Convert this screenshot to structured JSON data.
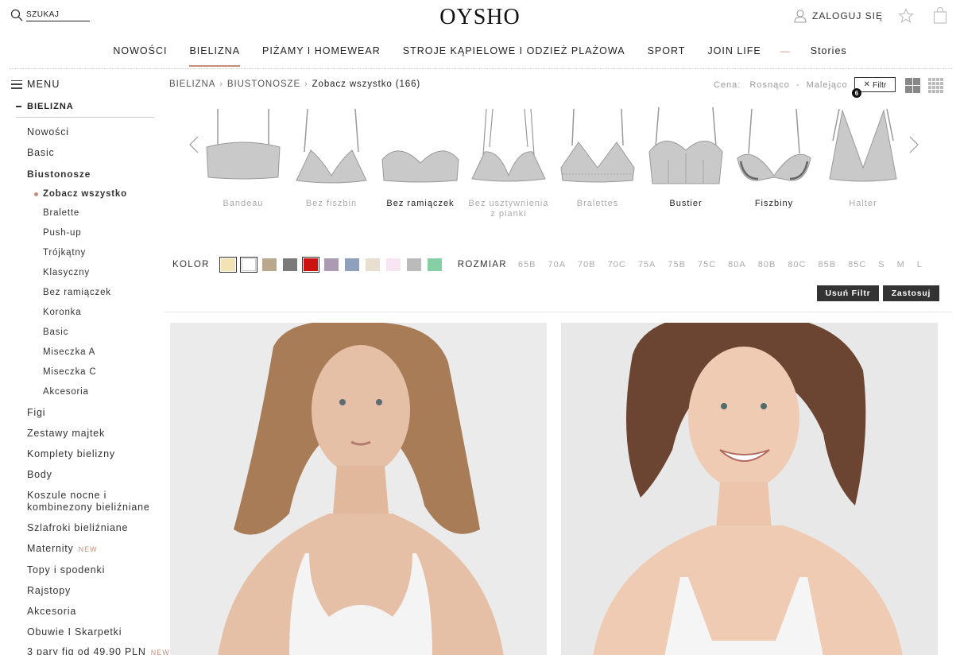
{
  "header": {
    "search_placeholder": "SZUKAJ",
    "logo": "OYSHO",
    "login_label": "ZALOGUJ SIĘ"
  },
  "topnav": [
    {
      "label": "NOWOŚCI"
    },
    {
      "label": "BIELIZNA",
      "active": true
    },
    {
      "label": "PIŻAMY I HOMEWEAR"
    },
    {
      "label": "STROJE KĄPIELOWE I ODZIEŻ PLAŻOWA"
    },
    {
      "label": "SPORT"
    },
    {
      "label": "JOIN LIFE"
    },
    {
      "label": "Stories"
    }
  ],
  "sidebar": {
    "menu_label": "MENU",
    "section": "BIELIZNA",
    "items": [
      {
        "label": "Nowości"
      },
      {
        "label": "Basic"
      },
      {
        "label": "Biustonosze"
      },
      {
        "label": "Zobacz wszystko"
      },
      {
        "label": "Bralette"
      },
      {
        "label": "Push-up"
      },
      {
        "label": "Trójkątny"
      },
      {
        "label": "Klasyczny"
      },
      {
        "label": "Bez ramiączek"
      },
      {
        "label": "Koronka"
      },
      {
        "label": "Basic"
      },
      {
        "label": "Miseczka A"
      },
      {
        "label": "Miseczka C"
      },
      {
        "label": "Akcesoria"
      },
      {
        "label": "Figi"
      },
      {
        "label": "Zestawy majtek"
      },
      {
        "label": "Komplety bielizny"
      },
      {
        "label": "Body"
      },
      {
        "label": "Koszule nocne i"
      },
      {
        "label": "kombinezony bieliźniane"
      },
      {
        "label": "Szlafroki bieliźniane"
      },
      {
        "label": "Maternity"
      },
      {
        "label": "Topy i spodenki"
      },
      {
        "label": "Rajstopy"
      },
      {
        "label": "Akcesoria"
      },
      {
        "label": "Obuwie I Skarpetki"
      },
      {
        "label": "3 pary fig od 49,90 PLN"
      }
    ],
    "new_tag": "NEW"
  },
  "breadcrumb": [
    "BIELIZNA",
    "BIUSTONOSZE",
    "Zobacz wszystko (166)"
  ],
  "sort": {
    "label": "Cena:",
    "asc": "Rosnąco",
    "sep": "-",
    "desc": "Malejąco"
  },
  "filter": {
    "button_label": "Filtr",
    "count": "6",
    "color_label": "KOLOR",
    "size_label": "ROZMIAR",
    "colors": [
      "#f3e2b3",
      "#ffffff",
      "#b9a88e",
      "#7a7a7a",
      "#cc1111",
      "#ab9ab1",
      "#8fa0bd",
      "#e9dfd1",
      "#f7e6f1",
      "#bbbbbb",
      "#86cfa4"
    ],
    "selected_colors": [
      0,
      1,
      4
    ],
    "sizes": [
      "65B",
      "70A",
      "70B",
      "70C",
      "75A",
      "75B",
      "75C",
      "80A",
      "80B",
      "80C",
      "85B",
      "85C",
      "S",
      "M",
      "L"
    ],
    "clear_label": "Usuń Filtr",
    "apply_label": "Zastosuj"
  },
  "categories": [
    {
      "label": "Bandeau",
      "icon": "bandeau-bra-icon"
    },
    {
      "label": "Bez fiszbin",
      "icon": "no-wire-bra-icon"
    },
    {
      "label": "Bez ramiączek",
      "icon": "strapless-bra-icon",
      "dark": true
    },
    {
      "label": "Bez usztywnienia z pianki",
      "icon": "unpadded-bra-icon"
    },
    {
      "label": "Bralettes",
      "icon": "bralette-icon"
    },
    {
      "label": "Bustier",
      "icon": "bustier-icon",
      "dark": true
    },
    {
      "label": "Fiszbiny",
      "icon": "underwire-bra-icon",
      "dark": true
    },
    {
      "label": "Halter",
      "icon": "halter-bra-icon"
    }
  ]
}
